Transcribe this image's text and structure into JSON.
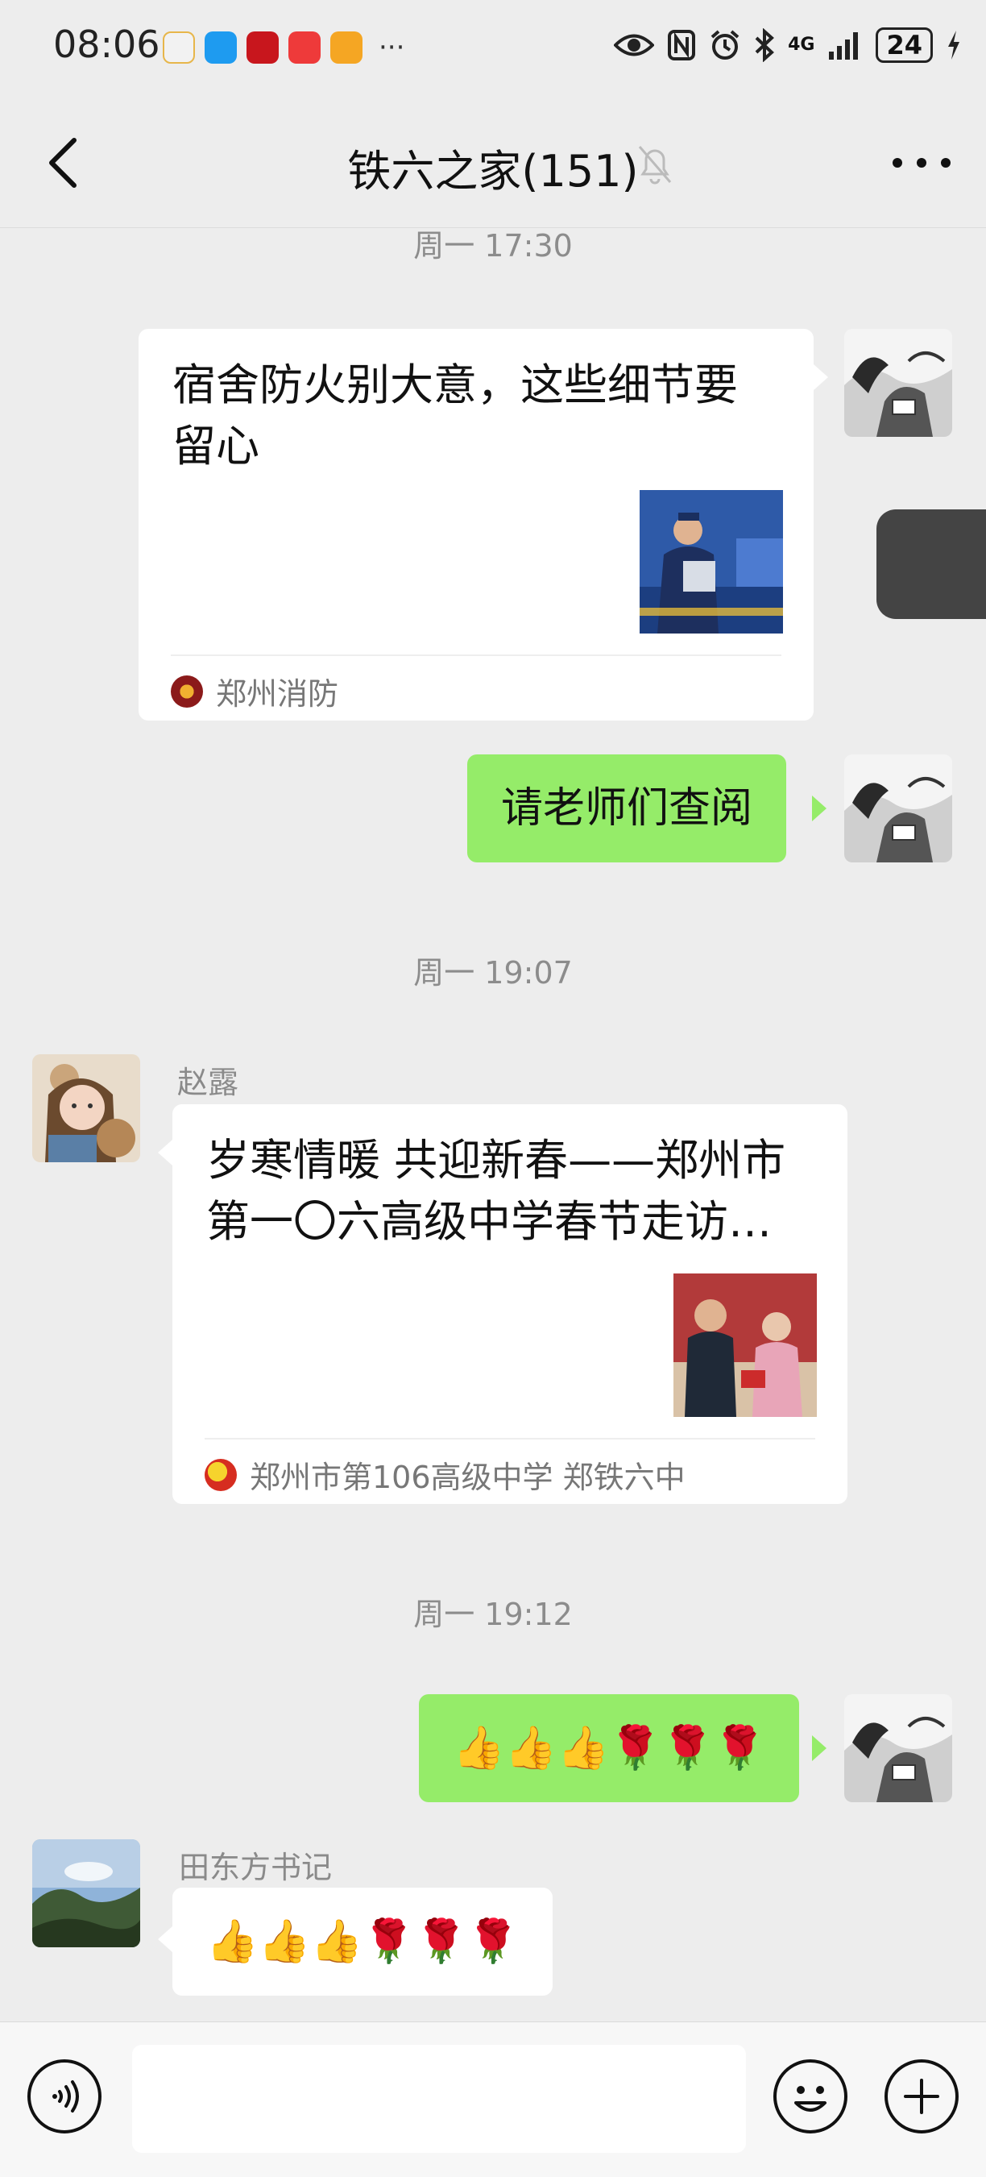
{
  "status_bar": {
    "time": "08:06",
    "battery": "24",
    "network": "4G",
    "icons": [
      "eye-icon",
      "nfc-icon",
      "alarm-icon",
      "bluetooth-icon",
      "signal-icon",
      "charging-icon"
    ],
    "more": "···"
  },
  "header": {
    "title": "铁六之家(151)",
    "icons": [
      "back-icon",
      "mute-bell-icon",
      "more-icon"
    ]
  },
  "messages": [
    {
      "type": "timestamp",
      "text": "周一 17:30"
    },
    {
      "type": "card",
      "side": "right",
      "title": "宿舍防火别大意，这些细节要留心",
      "source": "郑州消防"
    },
    {
      "type": "text",
      "side": "right",
      "text": "请老师们查阅"
    },
    {
      "type": "timestamp",
      "text": "周一 19:07"
    },
    {
      "type": "card",
      "side": "left",
      "sender": "赵露",
      "title": "岁寒情暖 共迎新春——郑州市第一〇六高级中学春节走访…",
      "source": "郑州市第106高级中学 郑铁六中"
    },
    {
      "type": "timestamp",
      "text": "周一 19:12"
    },
    {
      "type": "text",
      "side": "right",
      "text": "👍👍👍🌹🌹🌹"
    },
    {
      "type": "text",
      "side": "left",
      "sender": "田东方书记",
      "text": "👍👍👍🌹🌹🌹"
    }
  ],
  "input_bar": {
    "icons": [
      "voice-icon",
      "emoji-icon",
      "plus-icon"
    ],
    "value": ""
  },
  "colors": {
    "background": "#ededed",
    "own_bubble": "#95ec69",
    "other_bubble": "#ffffff"
  }
}
